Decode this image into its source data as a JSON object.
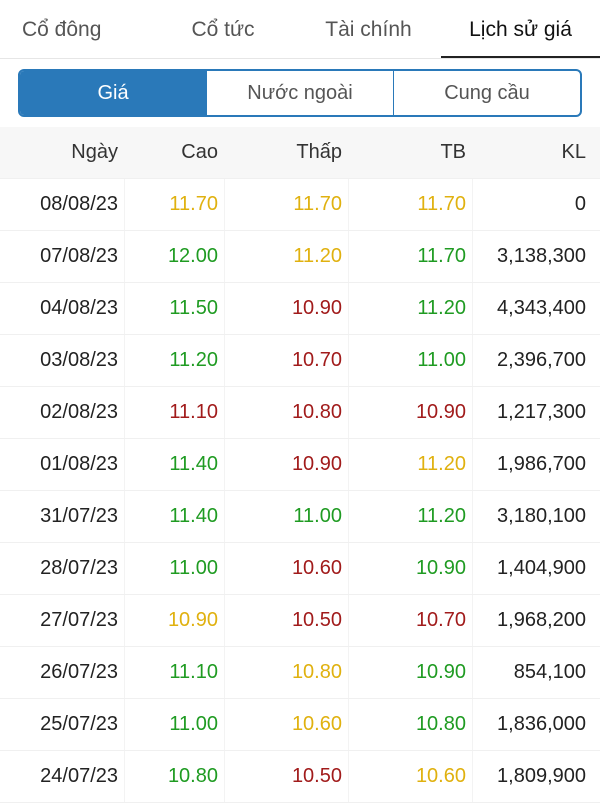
{
  "tabs": [
    {
      "label": "Cổ đông",
      "active": false
    },
    {
      "label": "Cổ tức",
      "active": false
    },
    {
      "label": "Tài chính",
      "active": false
    },
    {
      "label": "Lịch sử giá",
      "active": true
    }
  ],
  "segments": [
    {
      "label": "Giá",
      "active": true
    },
    {
      "label": "Nước ngoài",
      "active": false
    },
    {
      "label": "Cung cầu",
      "active": false
    }
  ],
  "table": {
    "headers": [
      "Ngày",
      "Cao",
      "Thấp",
      "TB",
      "KL"
    ],
    "rows": [
      {
        "date": "08/08/23",
        "cao": "11.70",
        "thap": "11.70",
        "tb": "11.70",
        "kl": "0"
      },
      {
        "date": "07/08/23",
        "cao": "12.00",
        "thap": "11.20",
        "tb": "11.70",
        "kl": "3,138,300"
      },
      {
        "date": "04/08/23",
        "cao": "11.50",
        "thap": "10.90",
        "tb": "11.20",
        "kl": "4,343,400"
      },
      {
        "date": "03/08/23",
        "cao": "11.20",
        "thap": "10.70",
        "tb": "11.00",
        "kl": "2,396,700"
      },
      {
        "date": "02/08/23",
        "cao": "11.10",
        "thap": "10.80",
        "tb": "10.90",
        "kl": "1,217,300"
      },
      {
        "date": "01/08/23",
        "cao": "11.40",
        "thap": "10.90",
        "tb": "11.20",
        "kl": "1,986,700"
      },
      {
        "date": "31/07/23",
        "cao": "11.40",
        "thap": "11.00",
        "tb": "11.20",
        "kl": "3,180,100"
      },
      {
        "date": "28/07/23",
        "cao": "11.00",
        "thap": "10.60",
        "tb": "10.90",
        "kl": "1,404,900"
      },
      {
        "date": "27/07/23",
        "cao": "10.90",
        "thap": "10.50",
        "tb": "10.70",
        "kl": "1,968,200"
      },
      {
        "date": "26/07/23",
        "cao": "11.10",
        "thap": "10.80",
        "tb": "10.90",
        "kl": "854,100"
      },
      {
        "date": "25/07/23",
        "cao": "11.00",
        "thap": "10.60",
        "tb": "10.80",
        "kl": "1,836,000"
      },
      {
        "date": "24/07/23",
        "cao": "10.80",
        "thap": "10.50",
        "tb": "10.60",
        "kl": "1,809,900"
      }
    ]
  },
  "colors": {
    "accent": "#2a79b9",
    "up": "#1f9b22",
    "down": "#a11b1b",
    "reference": "#e0b10f"
  },
  "row_colors": [
    [
      "yellow",
      "yellow",
      "yellow"
    ],
    [
      "green",
      "yellow",
      "green"
    ],
    [
      "green",
      "red",
      "green"
    ],
    [
      "green",
      "red",
      "green"
    ],
    [
      "red",
      "red",
      "red"
    ],
    [
      "green",
      "red",
      "yellow"
    ],
    [
      "green",
      "green",
      "green"
    ],
    [
      "green",
      "red",
      "green"
    ],
    [
      "yellow",
      "red",
      "red"
    ],
    [
      "green",
      "yellow",
      "green"
    ],
    [
      "green",
      "yellow",
      "green"
    ],
    [
      "green",
      "red",
      "yellow"
    ]
  ]
}
